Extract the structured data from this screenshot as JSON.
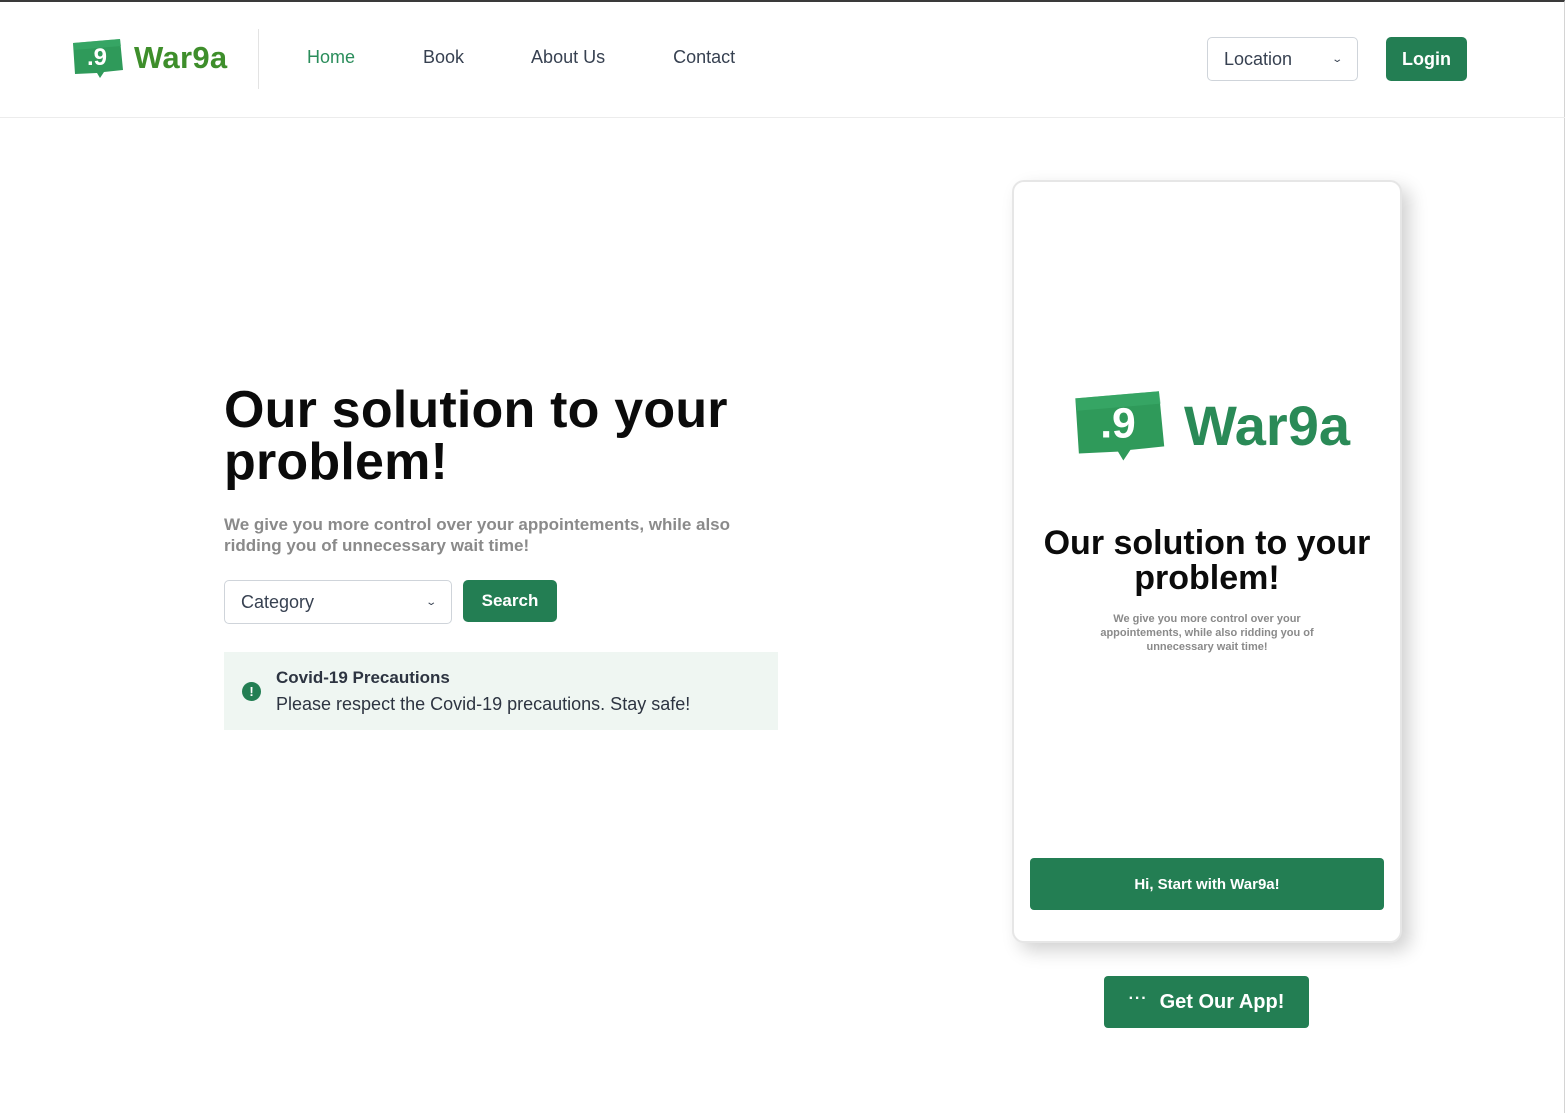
{
  "brand": {
    "name": "War9a",
    "logo_digit": ".9"
  },
  "nav": {
    "links": [
      {
        "label": "Home",
        "active": true
      },
      {
        "label": "Book"
      },
      {
        "label": "About Us"
      },
      {
        "label": "Contact"
      }
    ],
    "location_select": {
      "value": "Location",
      "icon": "chevron-down-icon"
    },
    "login_label": "Login"
  },
  "hero": {
    "title": "Our solution to your problem!",
    "subtitle": "We give you more control over your appointements, while also ridding you of unnecessary wait time!",
    "category_select": {
      "value": "Category",
      "icon": "chevron-down-icon"
    },
    "search_label": "Search"
  },
  "alert": {
    "icon": "exclamation-icon",
    "title": "Covid-19 Precautions",
    "text": "Please respect the Covid-19 precautions. Stay safe!"
  },
  "phone": {
    "brand_name": "War9a",
    "title": "Our solution to your problem!",
    "subtitle": "We give you more control over your appointements, while also ridding you of unnecessary wait time!",
    "cta_label": "Hi, Start with War9a!"
  },
  "get_app": {
    "label": "Get Our App!",
    "icon": "dots-icon"
  },
  "colors": {
    "primary": "#237e53",
    "brand_green": "#3e8e2b",
    "alert_bg": "#eff6f2",
    "muted_text": "#8a8a8a"
  }
}
